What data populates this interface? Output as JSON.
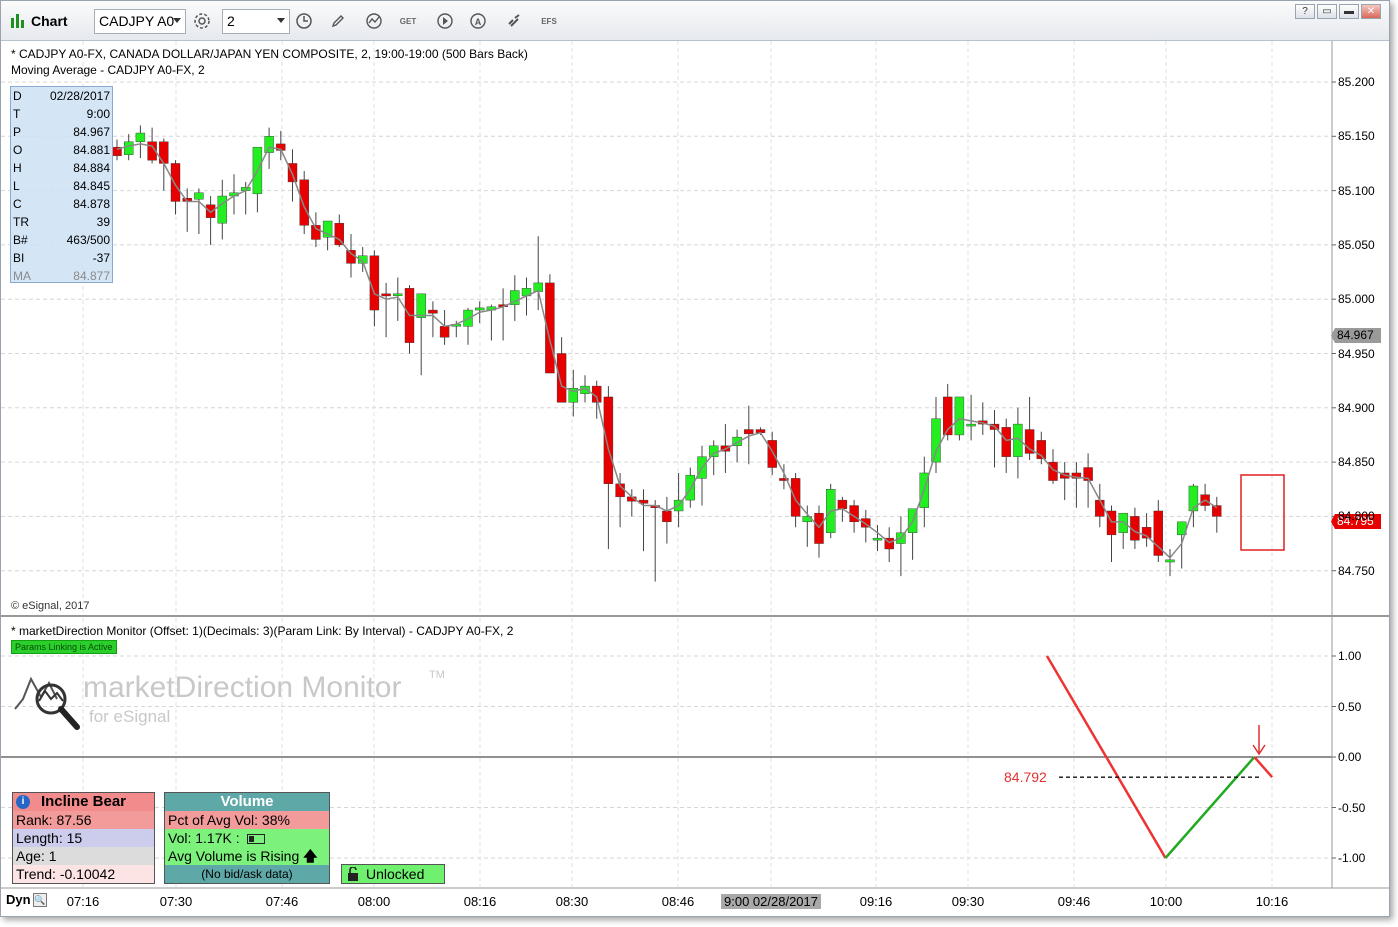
{
  "toolbar": {
    "title": "Chart",
    "symbol_value": "CADJPY A0",
    "interval_value": "2",
    "icons": [
      "chart-bars-icon",
      "settings-gear-icon",
      "clock-icon",
      "pencil-icon",
      "indicator-icon",
      "get-icon",
      "play-icon",
      "alert-icon",
      "link-icon",
      "efs-icon"
    ],
    "get_label": "GET",
    "efs_label": "EFS",
    "window_buttons": [
      "?",
      "▭",
      "▬",
      "✕"
    ]
  },
  "price_pane": {
    "header_line1": "* CADJPY A0-FX, CANADA DOLLAR/JAPAN YEN COMPOSITE, 2, 19:00-19:00 (500 Bars Back)",
    "header_line2": "Moving Average - CADJPY A0-FX, 2",
    "copyright": "© eSignal, 2017",
    "last_price_tag": "84.795",
    "cursor_price_tag": "84.967",
    "y_ticks": [
      "85.200",
      "85.150",
      "85.100",
      "85.050",
      "85.000",
      "84.950",
      "84.900",
      "84.850",
      "84.800",
      "84.750"
    ],
    "colors": {
      "up": "#22ee22",
      "down": "#e60000",
      "ma": "#888888",
      "tag_red": "#e60000"
    }
  },
  "data_window": {
    "rows": [
      {
        "k": "D",
        "v": "02/28/2017"
      },
      {
        "k": "T",
        "v": "9:00"
      },
      {
        "k": "P",
        "v": "84.967"
      },
      {
        "k": "O",
        "v": "84.881"
      },
      {
        "k": "H",
        "v": "84.884"
      },
      {
        "k": "L",
        "v": "84.845"
      },
      {
        "k": "C",
        "v": "84.878"
      },
      {
        "k": "TR",
        "v": "39"
      },
      {
        "k": "B#",
        "v": "463/500"
      },
      {
        "k": "BI",
        "v": "-37"
      },
      {
        "k": "MA",
        "v": "84.877"
      }
    ]
  },
  "indicator_pane": {
    "header": "* marketDirection Monitor (Offset: 1)(Decimals: 3)(Param Link: By Interval) - CADJPY A0-FX, 2",
    "params_badge": "Params Linking is Active",
    "logo_title": "marketDirection Monitor",
    "logo_tm": "TM",
    "logo_sub": "for eSignal",
    "level_label": "84.792",
    "y_ticks": [
      "1.00",
      "0.50",
      "0.00",
      "-0.50",
      "-1.00"
    ],
    "trend": {
      "title": "Incline Bear",
      "rank": "Rank: 87.56",
      "length": "Length: 15",
      "age": "Age: 1",
      "trend": "Trend: -0.10042"
    },
    "volume": {
      "title": "Volume",
      "pct": "Pct of Avg Vol: 38%",
      "vol": "Vol: 1.17K :",
      "rising": "Avg Volume is Rising",
      "bidask": "(No bid/ask data)"
    },
    "unlocked_label": "Unlocked"
  },
  "x_axis": {
    "dyn_label": "Dyn",
    "ticks": [
      "07:16",
      "07:30",
      "07:46",
      "08:00",
      "08:16",
      "08:30",
      "08:46",
      "9:00 02/28/2017",
      "09:16",
      "09:30",
      "09:46",
      "10:00",
      "10:16"
    ]
  },
  "chart_data": {
    "type": "candlestick",
    "ylim": [
      84.725,
      85.225
    ],
    "candles": [
      [
        85.14,
        85.147,
        85.128,
        85.132
      ],
      [
        85.133,
        85.152,
        85.128,
        85.145
      ],
      [
        85.145,
        85.16,
        85.13,
        85.153
      ],
      [
        85.145,
        85.158,
        85.125,
        85.128
      ],
      [
        85.145,
        85.148,
        85.1,
        85.125
      ],
      [
        85.125,
        85.128,
        85.078,
        85.09
      ],
      [
        85.093,
        85.102,
        85.062,
        85.09
      ],
      [
        85.092,
        85.102,
        85.06,
        85.098
      ],
      [
        85.087,
        85.095,
        85.05,
        85.075
      ],
      [
        85.07,
        85.11,
        85.055,
        85.095
      ],
      [
        85.095,
        85.115,
        85.078,
        85.098
      ],
      [
        85.1,
        85.108,
        85.078,
        85.103
      ],
      [
        85.097,
        85.135,
        85.08,
        85.14
      ],
      [
        85.135,
        85.158,
        85.12,
        85.15
      ],
      [
        85.143,
        85.155,
        85.128,
        85.137
      ],
      [
        85.125,
        85.138,
        85.09,
        85.108
      ],
      [
        85.11,
        85.118,
        85.06,
        85.068
      ],
      [
        85.068,
        85.08,
        85.048,
        85.055
      ],
      [
        85.057,
        85.07,
        85.045,
        85.072
      ],
      [
        85.07,
        85.078,
        85.048,
        85.05
      ],
      [
        85.045,
        85.06,
        85.02,
        85.033
      ],
      [
        85.033,
        85.048,
        85.025,
        85.04
      ],
      [
        85.04,
        85.045,
        84.975,
        84.99
      ],
      [
        85.005,
        85.015,
        84.965,
        85.003
      ],
      [
        85.005,
        85.02,
        84.98,
        85.005
      ],
      [
        85.01,
        85.013,
        84.95,
        84.96
      ],
      [
        84.983,
        84.995,
        84.93,
        85.005
      ],
      [
        84.99,
        84.998,
        84.965,
        84.987
      ],
      [
        84.975,
        84.99,
        84.958,
        84.965
      ],
      [
        84.975,
        84.98,
        84.965,
        84.977
      ],
      [
        84.975,
        84.992,
        84.958,
        84.99
      ],
      [
        84.99,
        84.998,
        84.978,
        84.992
      ],
      [
        84.99,
        84.995,
        84.962,
        84.993
      ],
      [
        84.995,
        85.01,
        84.962,
        84.993
      ],
      [
        84.995,
        85.022,
        84.98,
        85.008
      ],
      [
        85.003,
        85.02,
        84.985,
        85.01
      ],
      [
        85.007,
        85.058,
        84.99,
        85.015
      ],
      [
        85.015,
        85.023,
        84.965,
        84.932
      ],
      [
        84.95,
        84.965,
        84.91,
        84.905
      ],
      [
        84.905,
        84.935,
        84.892,
        84.918
      ],
      [
        84.913,
        84.93,
        84.905,
        84.92
      ],
      [
        84.92,
        84.925,
        84.89,
        84.905
      ],
      [
        84.91,
        84.92,
        84.77,
        84.83
      ],
      [
        84.83,
        84.84,
        84.79,
        84.818
      ],
      [
        84.818,
        84.825,
        84.8,
        84.814
      ],
      [
        84.815,
        84.825,
        84.768,
        84.812
      ],
      [
        84.81,
        84.815,
        84.74,
        84.808
      ],
      [
        84.805,
        84.818,
        84.775,
        84.795
      ],
      [
        84.805,
        84.84,
        84.79,
        84.815
      ],
      [
        84.815,
        84.845,
        84.808,
        84.838
      ],
      [
        84.835,
        84.865,
        84.81,
        84.855
      ],
      [
        84.855,
        84.87,
        84.838,
        84.865
      ],
      [
        84.865,
        84.885,
        84.84,
        84.86
      ],
      [
        84.865,
        84.88,
        84.85,
        84.873
      ],
      [
        84.88,
        84.902,
        84.848,
        84.876
      ],
      [
        84.88,
        84.882,
        84.875,
        84.877
      ],
      [
        84.87,
        84.878,
        84.838,
        84.845
      ],
      [
        84.835,
        84.848,
        84.825,
        84.833
      ],
      [
        84.835,
        84.84,
        84.79,
        84.8
      ],
      [
        84.795,
        84.81,
        84.772,
        84.8
      ],
      [
        84.803,
        84.81,
        84.762,
        84.775
      ],
      [
        84.785,
        84.83,
        84.78,
        84.825
      ],
      [
        84.815,
        84.818,
        84.795,
        84.807
      ],
      [
        84.81,
        84.815,
        84.785,
        84.795
      ],
      [
        84.798,
        84.806,
        84.776,
        84.79
      ],
      [
        84.78,
        84.792,
        84.768,
        84.78
      ],
      [
        84.78,
        84.79,
        84.758,
        84.77
      ],
      [
        84.775,
        84.8,
        84.745,
        84.785
      ],
      [
        84.785,
        84.795,
        84.76,
        84.807
      ],
      [
        84.808,
        84.855,
        84.79,
        84.84
      ],
      [
        84.85,
        84.91,
        84.84,
        84.89
      ],
      [
        84.91,
        84.922,
        84.87,
        84.875
      ],
      [
        84.875,
        84.905,
        84.87,
        84.91
      ],
      [
        84.885,
        84.912,
        84.87,
        84.885
      ],
      [
        84.888,
        84.905,
        84.875,
        84.885
      ],
      [
        84.885,
        84.898,
        84.845,
        84.88
      ],
      [
        84.882,
        84.89,
        84.84,
        84.855
      ],
      [
        84.855,
        84.9,
        84.835,
        84.885
      ],
      [
        84.88,
        84.91,
        84.852,
        84.858
      ],
      [
        84.87,
        84.878,
        84.848,
        84.853
      ],
      [
        84.85,
        84.862,
        84.83,
        84.833
      ],
      [
        84.84,
        84.85,
        84.815,
        84.835
      ],
      [
        84.84,
        84.85,
        84.808,
        84.835
      ],
      [
        84.845,
        84.858,
        84.808,
        84.833
      ],
      [
        84.815,
        84.83,
        84.79,
        84.8
      ],
      [
        84.805,
        84.81,
        84.758,
        84.783
      ],
      [
        84.785,
        84.802,
        84.77,
        84.803
      ],
      [
        84.8,
        84.808,
        84.77,
        84.778
      ],
      [
        84.79,
        84.803,
        84.772,
        84.78
      ],
      [
        84.805,
        84.815,
        84.758,
        84.764
      ],
      [
        84.758,
        84.77,
        84.745,
        84.76
      ],
      [
        84.783,
        84.795,
        84.752,
        84.795
      ],
      [
        84.805,
        84.83,
        84.79,
        84.828
      ],
      [
        84.82,
        84.83,
        84.805,
        84.81
      ],
      [
        84.81,
        84.818,
        84.785,
        84.8
      ]
    ],
    "ma": [
      85.138,
      85.141,
      85.143,
      85.141,
      85.125,
      85.105,
      85.09,
      85.09,
      85.08,
      85.088,
      85.095,
      85.1,
      85.118,
      85.14,
      85.138,
      85.115,
      85.085,
      85.065,
      85.06,
      85.055,
      85.042,
      85.035,
      85.005,
      85.0,
      85.002,
      84.985,
      84.985,
      84.985,
      84.975,
      84.977,
      84.982,
      84.988,
      84.99,
      84.993,
      84.998,
      85.003,
      85.008,
      84.962,
      84.92,
      84.915,
      84.918,
      84.91,
      84.862,
      84.828,
      84.818,
      84.81,
      84.81,
      84.805,
      84.81,
      84.825,
      84.845,
      84.858,
      84.862,
      84.868,
      84.874,
      84.877,
      84.86,
      84.84,
      84.815,
      84.802,
      84.79,
      84.805,
      84.807,
      84.8,
      84.793,
      84.785,
      84.776,
      84.78,
      84.795,
      84.825,
      84.86,
      84.88,
      84.89,
      84.888,
      84.886,
      84.883,
      84.87,
      84.872,
      84.862,
      84.856,
      84.843,
      84.838,
      84.836,
      84.835,
      84.815,
      84.795,
      84.795,
      84.786,
      84.782,
      84.772,
      84.762,
      84.775,
      84.808,
      84.815,
      84.808
    ],
    "x_start": 116,
    "x_step": 11.7,
    "indicator": {
      "ylim": [
        -1.2,
        1.2
      ],
      "red_line": [
        [
          0,
          1.0
        ],
        [
          10,
          -1.0
        ]
      ],
      "green_line": [
        [
          10,
          -1.0
        ],
        [
          17.5,
          0.0
        ]
      ],
      "red_tail": [
        [
          17.5,
          0.0
        ],
        [
          19,
          -0.2
        ]
      ],
      "level": -0.2,
      "arrow_direction": "down"
    }
  }
}
